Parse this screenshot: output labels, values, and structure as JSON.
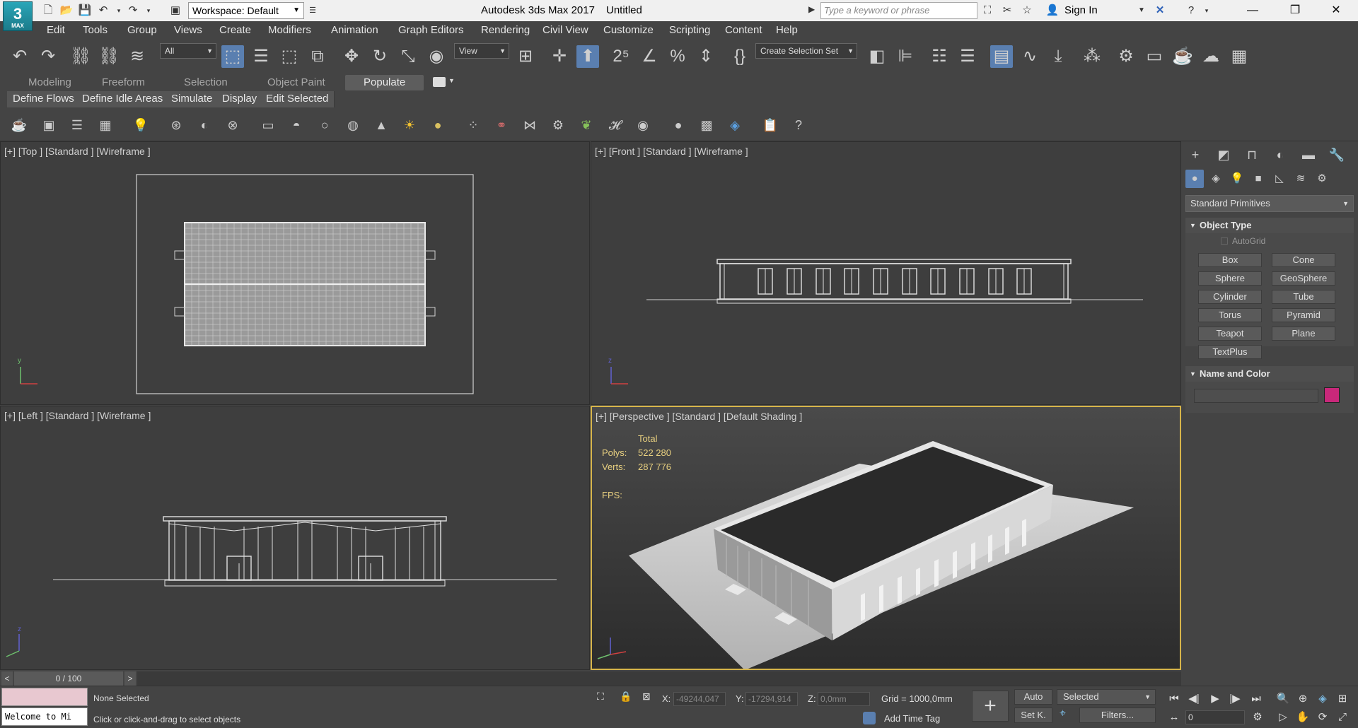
{
  "titlebar": {
    "logo": "3",
    "logo_sub": "MAX",
    "workspace": "Workspace: Default",
    "app_title": "Autodesk 3ds Max 2017",
    "doc_name": "Untitled",
    "search_placeholder": "Type a keyword or phrase",
    "sign_in": "Sign In"
  },
  "menu": [
    "Edit",
    "Tools",
    "Group",
    "Views",
    "Create",
    "Modifiers",
    "Animation",
    "Graph Editors",
    "Rendering",
    "Civil View",
    "Customize",
    "Scripting",
    "Content",
    "Help"
  ],
  "toolbar": {
    "filter": "All",
    "ref_coord": "View",
    "selection_set": "Create Selection Set"
  },
  "ribbon": {
    "tabs": [
      "Modeling",
      "Freeform",
      "Selection",
      "Object Paint",
      "Populate"
    ],
    "selected": "Populate",
    "subtabs": [
      "Define Flows",
      "Define Idle Areas",
      "Simulate",
      "Display",
      "Edit Selected"
    ]
  },
  "viewports": {
    "top": "[+] [Top ] [Standard ] [Wireframe ]",
    "front": "[+] [Front ] [Standard ] [Wireframe ]",
    "left": "[+] [Left ] [Standard ] [Wireframe ]",
    "perspective": "[+] [Perspective ] [Standard ] [Default Shading ]",
    "stats": {
      "total_label": "Total",
      "polys_label": "Polys:",
      "polys": "522 280",
      "verts_label": "Verts:",
      "verts": "287 776",
      "fps_label": "FPS:"
    }
  },
  "command_panel": {
    "category": "Standard Primitives",
    "object_type_title": "Object Type",
    "autogrid": "AutoGrid",
    "primitives": [
      "Box",
      "Cone",
      "Sphere",
      "GeoSphere",
      "Cylinder",
      "Tube",
      "Torus",
      "Pyramid",
      "Teapot",
      "Plane",
      "TextPlus"
    ],
    "name_color_title": "Name and Color",
    "object_color": "#c8287a"
  },
  "timeline": {
    "frame": "0 / 100",
    "prev": "<",
    "next": ">"
  },
  "status": {
    "maxscript": "Welcome to Mi",
    "selection": "None Selected",
    "prompt": "Click or click-and-drag to select objects",
    "x_label": "X:",
    "x": "-49244,047",
    "y_label": "Y:",
    "y": "-17294,914",
    "z_label": "Z:",
    "z": "0,0mm",
    "grid": "Grid = 1000,0mm",
    "add_time_tag": "Add Time Tag",
    "auto": "Auto",
    "set_key": "Set K.",
    "key_filter": "Selected",
    "filters": "Filters...",
    "frame_value": "0"
  }
}
